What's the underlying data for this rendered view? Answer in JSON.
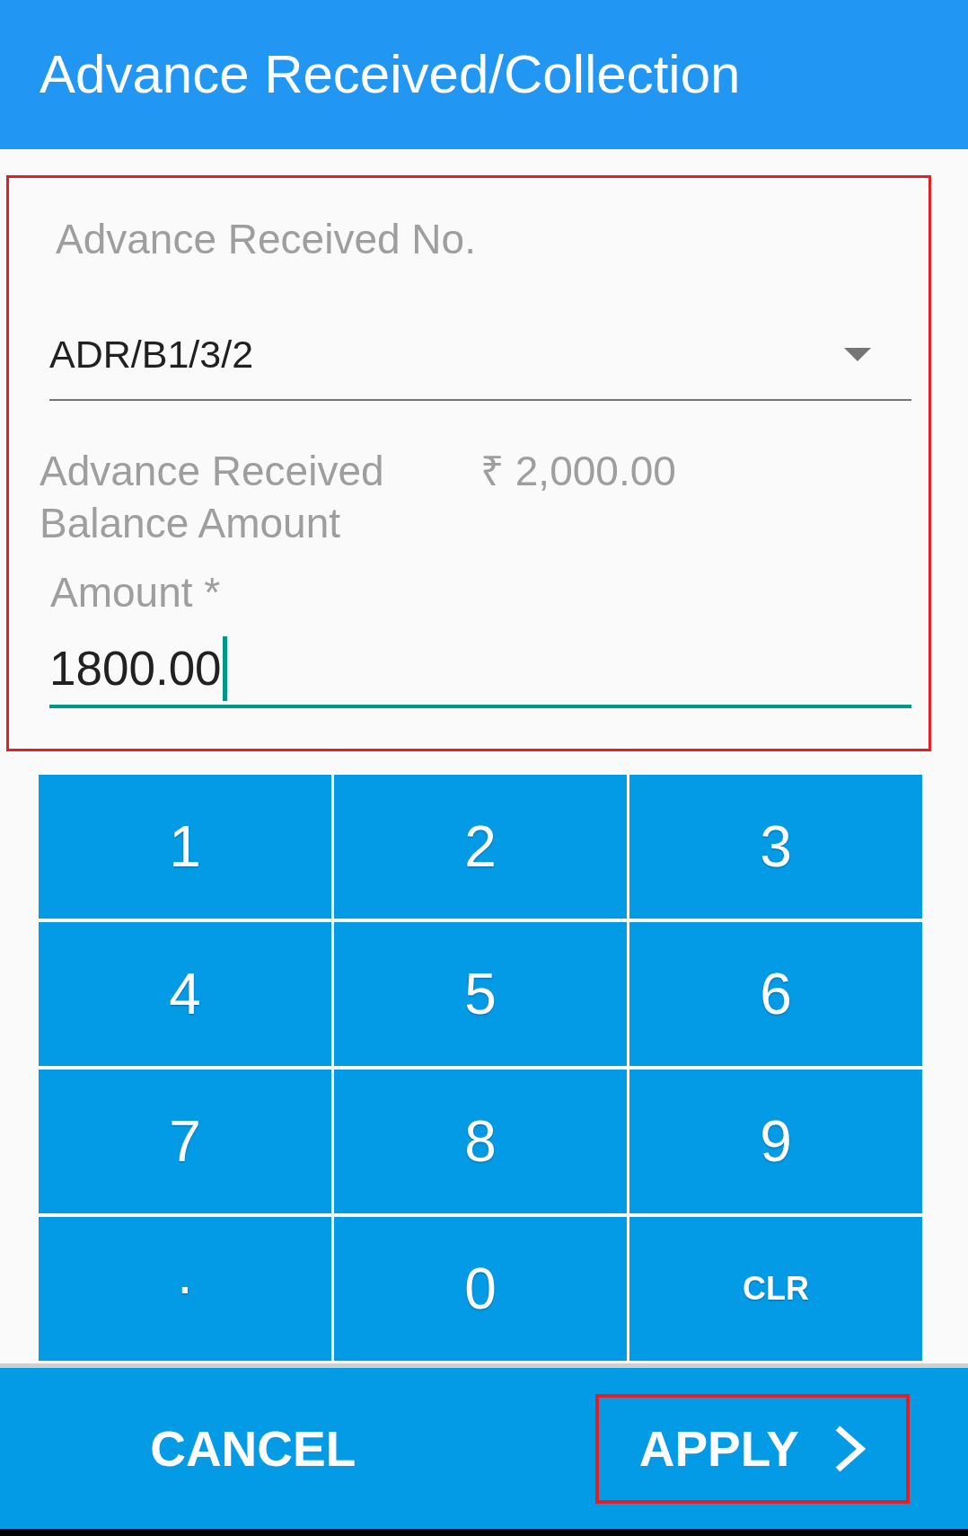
{
  "app_bar": {
    "title": "Advance Received/Collection"
  },
  "form": {
    "highlighted": true,
    "advance_no": {
      "label": "Advance Received No.",
      "value": "ADR/B1/3/2"
    },
    "balance": {
      "label": "Advance Received Balance Amount",
      "value": "₹ 2,000.00"
    },
    "amount": {
      "label": "Amount *",
      "value": "1800.00",
      "focused": true
    }
  },
  "keypad": {
    "keys": [
      {
        "label": "1",
        "kind": "digit"
      },
      {
        "label": "2",
        "kind": "digit"
      },
      {
        "label": "3",
        "kind": "digit"
      },
      {
        "label": "4",
        "kind": "digit"
      },
      {
        "label": "5",
        "kind": "digit"
      },
      {
        "label": "6",
        "kind": "digit"
      },
      {
        "label": "7",
        "kind": "digit"
      },
      {
        "label": "8",
        "kind": "digit"
      },
      {
        "label": "9",
        "kind": "digit"
      },
      {
        "label": ".",
        "kind": "decimal"
      },
      {
        "label": "0",
        "kind": "digit"
      },
      {
        "label": "CLR",
        "kind": "action"
      }
    ]
  },
  "footer": {
    "buttons": [
      {
        "label": "CANCEL",
        "kind": "cancel",
        "highlighted": false
      },
      {
        "label": "APPLY",
        "kind": "apply",
        "highlighted": true
      }
    ]
  }
}
